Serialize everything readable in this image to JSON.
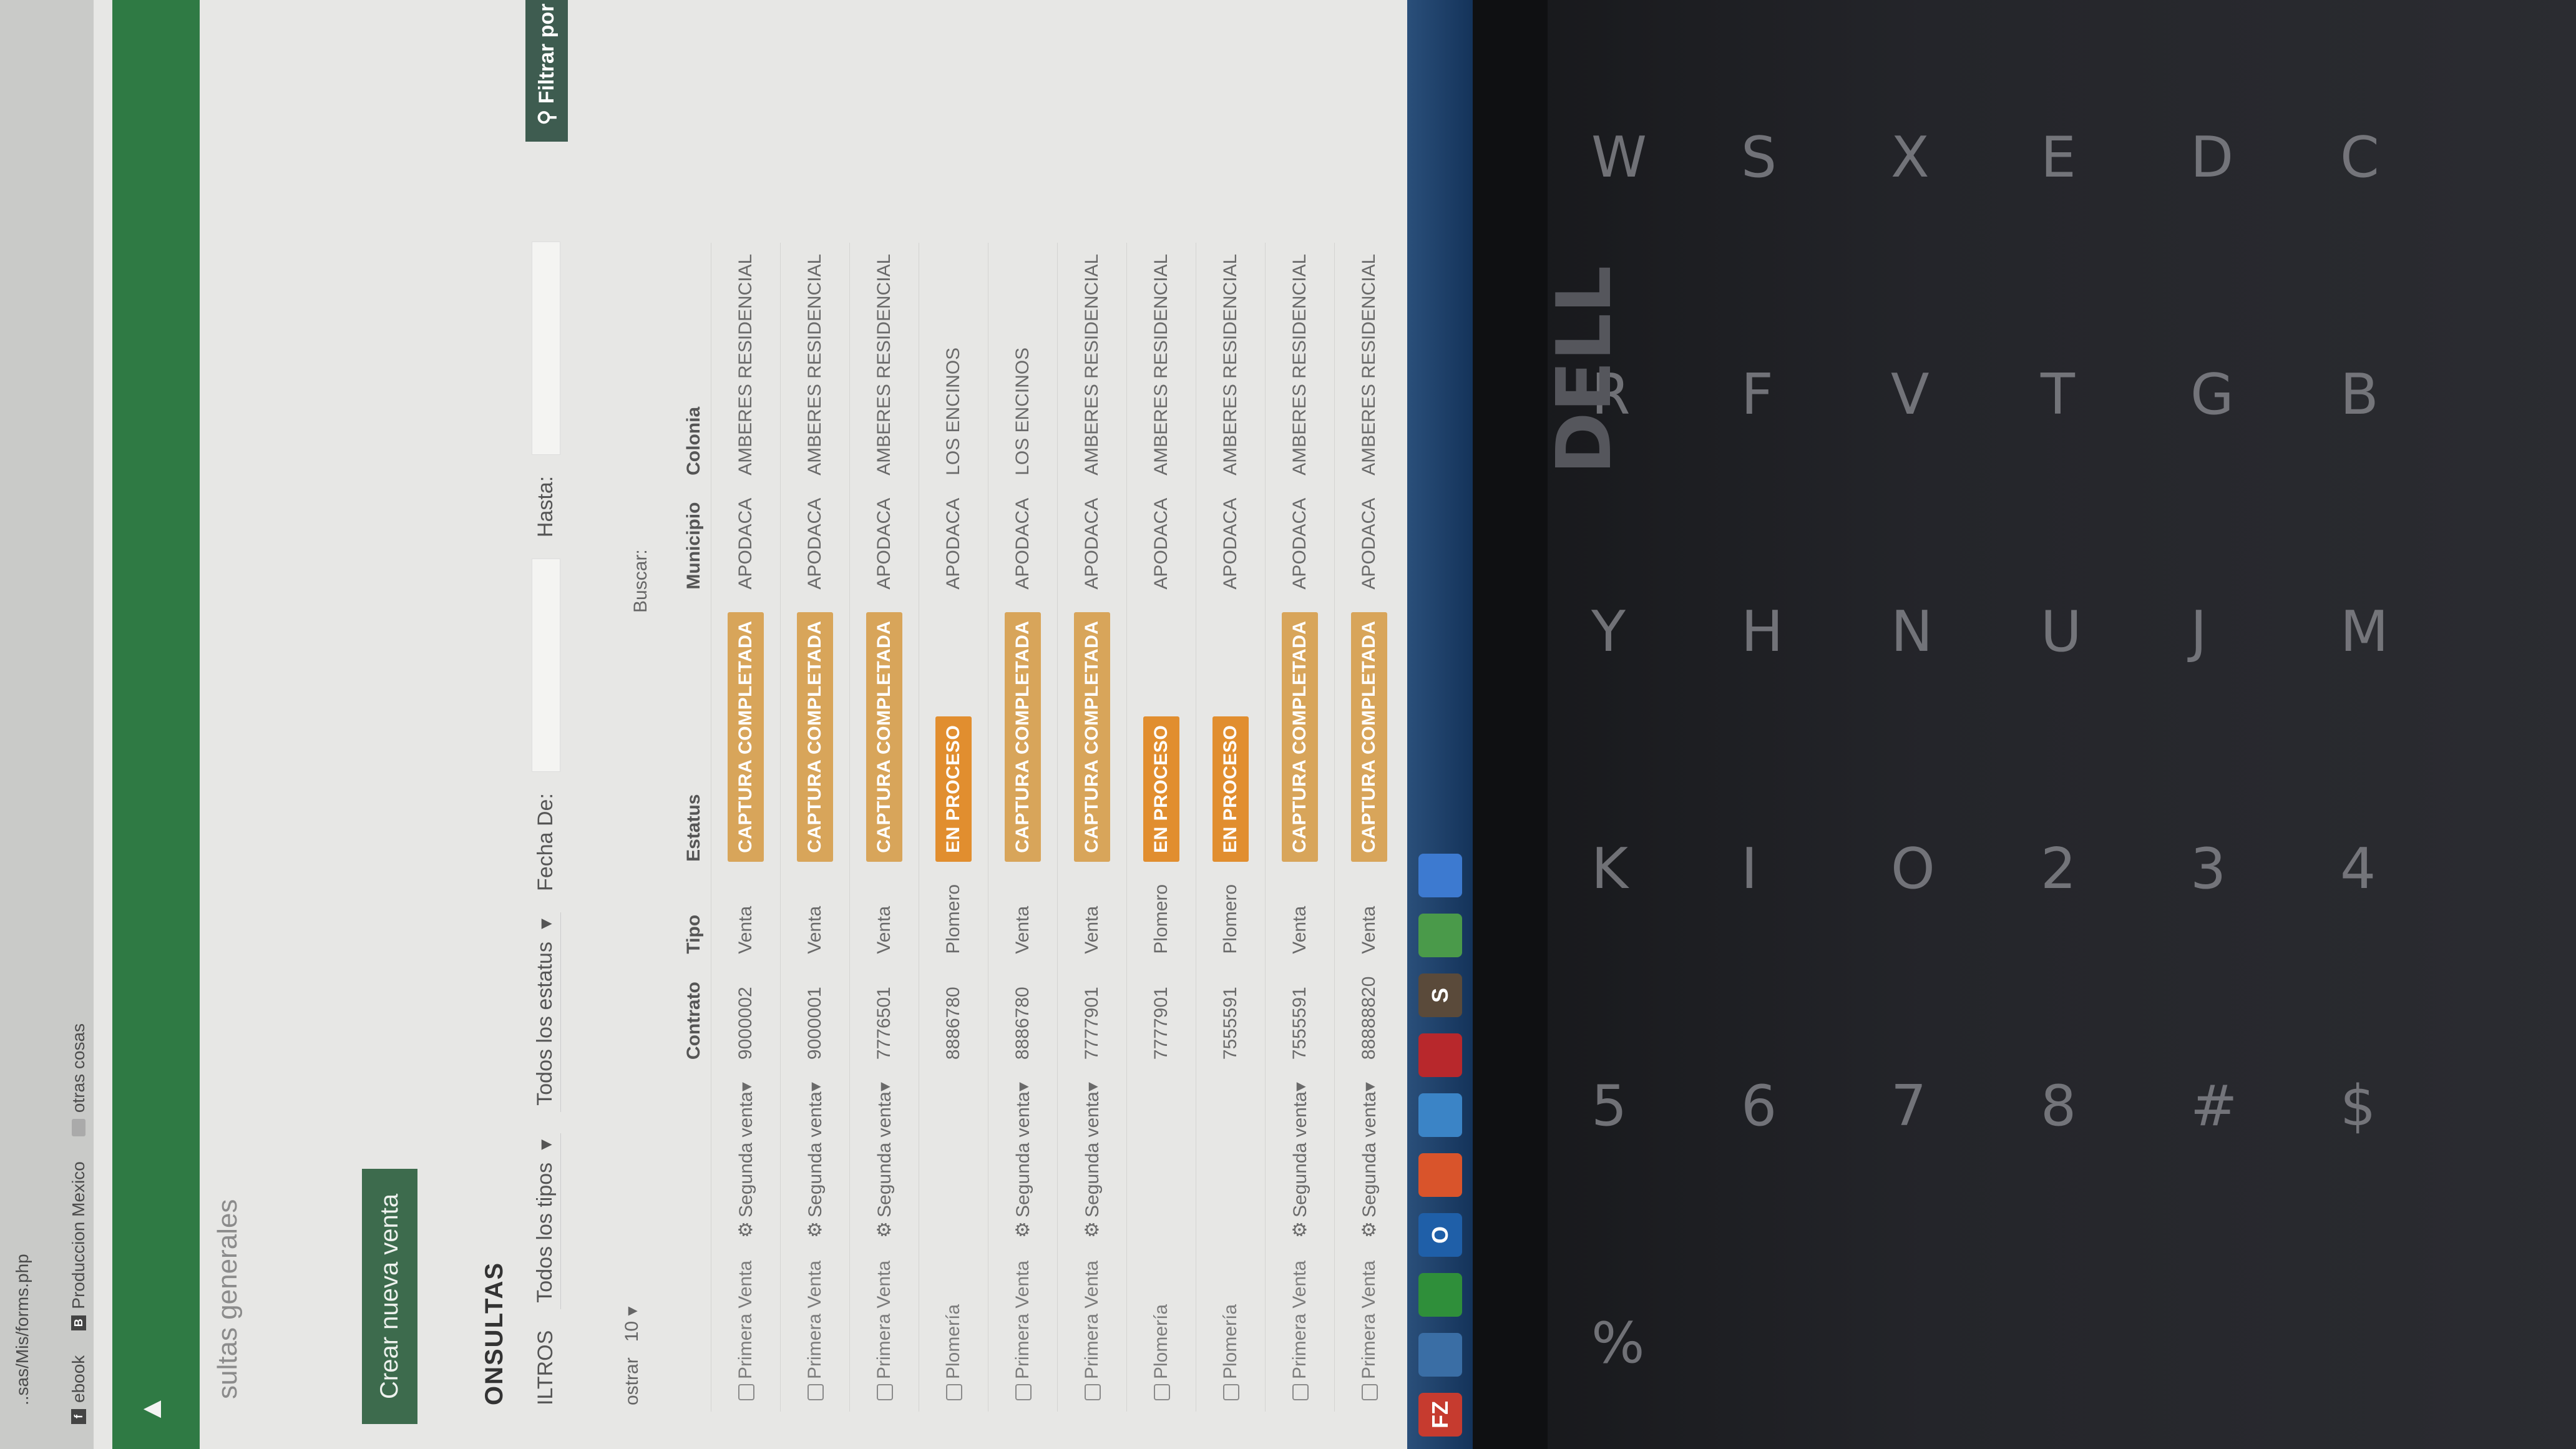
{
  "browser": {
    "url_fragment": "..sas/Mis/forms.php",
    "bookmarks": [
      {
        "label": "ebook",
        "icon": "facebook-icon"
      },
      {
        "label": "Produccion Mexico",
        "icon": "b-bookmark-icon"
      },
      {
        "label": "otras cosas",
        "icon": "folder-icon"
      }
    ]
  },
  "page": {
    "breadcrumb": "sultas generales",
    "create_button": "Crear nueva venta",
    "section_title": "ONSULTAS",
    "filters_label": "ILTROS",
    "type_select": "Todos los tipos",
    "status_select": "Todos los estatus",
    "date_from_label": "Fecha De:",
    "date_to_label": "Hasta:",
    "filter_button": "Filtrar por fe",
    "show_label": "ostrar",
    "show_value": "10",
    "search_label": "Buscar:"
  },
  "table": {
    "headers": [
      "",
      "",
      "Contrato",
      "Tipo",
      "Estatus",
      "Municipio",
      "Colonia"
    ],
    "rows": [
      {
        "a": "Primera Venta",
        "b": "Segunda venta",
        "contrato": "9000002",
        "tipo": "Venta",
        "estatus": "CAPTURA COMPLETADA",
        "status_kind": "completa",
        "municipio": "APODACA",
        "colonia": "AMBERES RESIDENCIAL"
      },
      {
        "a": "Primera Venta",
        "b": "Segunda venta",
        "contrato": "9000001",
        "tipo": "Venta",
        "estatus": "CAPTURA COMPLETADA",
        "status_kind": "completa",
        "municipio": "APODACA",
        "colonia": "AMBERES RESIDENCIAL"
      },
      {
        "a": "Primera Venta",
        "b": "Segunda venta",
        "contrato": "7776501",
        "tipo": "Venta",
        "estatus": "CAPTURA COMPLETADA",
        "status_kind": "completa",
        "municipio": "APODACA",
        "colonia": "AMBERES RESIDENCIAL"
      },
      {
        "a": "Plomería",
        "b": "",
        "contrato": "8886780",
        "tipo": "Plomero",
        "estatus": "EN PROCESO",
        "status_kind": "proceso",
        "municipio": "APODACA",
        "colonia": "LOS ENCINOS"
      },
      {
        "a": "Primera Venta",
        "b": "Segunda venta",
        "contrato": "8886780",
        "tipo": "Venta",
        "estatus": "CAPTURA COMPLETADA",
        "status_kind": "completa",
        "municipio": "APODACA",
        "colonia": "LOS ENCINOS"
      },
      {
        "a": "Primera Venta",
        "b": "Segunda venta",
        "contrato": "7777901",
        "tipo": "Venta",
        "estatus": "CAPTURA COMPLETADA",
        "status_kind": "completa",
        "municipio": "APODACA",
        "colonia": "AMBERES RESIDENCIAL"
      },
      {
        "a": "Plomería",
        "b": "",
        "contrato": "7777901",
        "tipo": "Plomero",
        "estatus": "EN PROCESO",
        "status_kind": "proceso",
        "municipio": "APODACA",
        "colonia": "AMBERES RESIDENCIAL"
      },
      {
        "a": "Plomería",
        "b": "",
        "contrato": "7555591",
        "tipo": "Plomero",
        "estatus": "EN PROCESO",
        "status_kind": "proceso",
        "municipio": "APODACA",
        "colonia": "AMBERES RESIDENCIAL"
      },
      {
        "a": "Primera Venta",
        "b": "Segunda venta",
        "contrato": "7555591",
        "tipo": "Venta",
        "estatus": "CAPTURA COMPLETADA",
        "status_kind": "completa",
        "municipio": "APODACA",
        "colonia": "AMBERES RESIDENCIAL"
      },
      {
        "a": "Primera Venta",
        "b": "Segunda venta",
        "contrato": "88888820",
        "tipo": "Venta",
        "estatus": "CAPTURA COMPLETADA",
        "status_kind": "completa",
        "municipio": "APODACA",
        "colonia": "AMBERES RESIDENCIAL"
      }
    ]
  },
  "taskbar": [
    {
      "label": "FZ",
      "color": "#c63b2f",
      "icon": "filezilla-icon"
    },
    {
      "label": "",
      "color": "#3a6ea5",
      "icon": "app-icon"
    },
    {
      "label": "",
      "color": "#2f8f3a",
      "icon": "chrome-icon"
    },
    {
      "label": "O",
      "color": "#1f5fa8",
      "icon": "outlook-icon"
    },
    {
      "label": "",
      "color": "#d9542b",
      "icon": "media-icon"
    },
    {
      "label": "",
      "color": "#3b84c6",
      "icon": "box-icon"
    },
    {
      "label": "",
      "color": "#b8282c",
      "icon": "calendar-icon"
    },
    {
      "label": "S",
      "color": "#5a4a3a",
      "icon": "sublime-icon"
    },
    {
      "label": "",
      "color": "#4a9a4a",
      "icon": "excel-icon"
    },
    {
      "label": "",
      "color": "#3d7ad0",
      "icon": "chrome-icon-2"
    }
  ],
  "colors": {
    "brand_green": "#2f7a44",
    "badge_completa": "#d8a55a",
    "badge_proceso": "#e18e2f"
  },
  "keyboard_keys": [
    "W",
    "S",
    "X",
    "E",
    "D",
    "C",
    "R",
    "F",
    "V",
    "T",
    "G",
    "B",
    "Y",
    "H",
    "N",
    "U",
    "J",
    "M",
    "K",
    "I",
    "O",
    "2",
    "3",
    "4",
    "5",
    "6",
    "7",
    "8",
    "#",
    "$",
    "%"
  ],
  "hardware": {
    "brand": "DELL"
  }
}
